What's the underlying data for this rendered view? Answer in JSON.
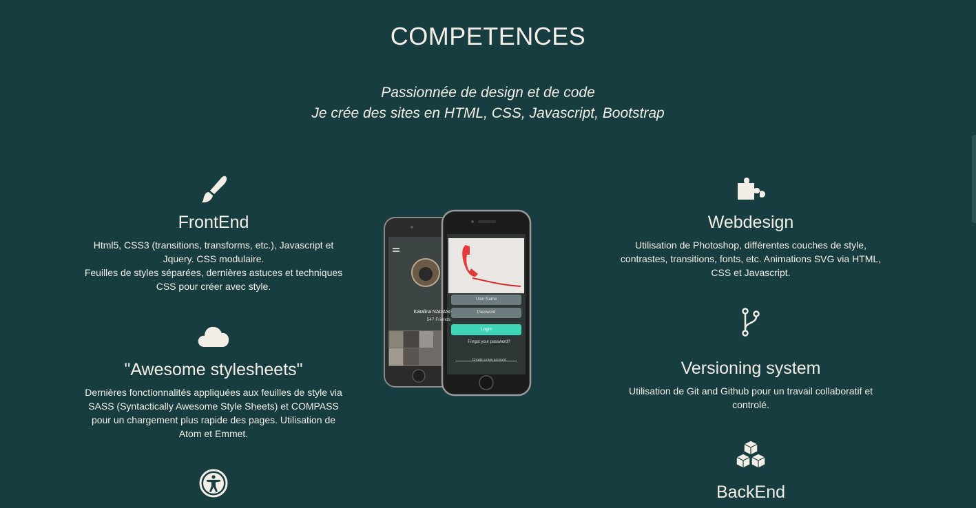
{
  "section": {
    "title": "COMPETENCES",
    "tagline_line1": "Passionnée de design et de code",
    "tagline_line2": "Je crée des sites en HTML, CSS, Javascript, Bootstrap"
  },
  "skills": {
    "frontend": {
      "icon": "paintbrush-icon",
      "title": "FrontEnd",
      "line1": "Html5, CSS3 (transitions, transforms, etc.), Javascript et Jquery. CSS modulaire.",
      "line2": "Feuilles de styles séparées, dernières astuces et techniques CSS pour créer avec style."
    },
    "stylesheets": {
      "icon": "cloud-icon",
      "title": "\"Awesome stylesheets\"",
      "desc": "Dernières fonctionnalités appliquées aux feuilles de style via SASS (Syntactically Awesome Style Sheets) et COMPASS pour un chargement plus rapide des pages. Utilisation de Atom et Emmet."
    },
    "accessibility": {
      "icon": "accessibility-icon"
    },
    "webdesign": {
      "icon": "puzzle-icon",
      "title": "Webdesign",
      "desc": "Utilisation de Photoshop, différentes couches de style, contrastes, transitions, fonts, etc. Animations SVG via HTML, CSS et Javascript."
    },
    "versioning": {
      "icon": "git-branch-icon",
      "title": "Versioning system",
      "desc": "Utilisation de Git and Github pour un travail collaboratif et controlé."
    },
    "backend": {
      "icon": "cubes-icon",
      "title": "BackEnd"
    }
  },
  "mockup": {
    "profile_name": "Katalina NADASI",
    "profile_friends": "547 Friends",
    "field_username": "User Name",
    "field_password": "Password",
    "login_label": "Login",
    "forgot_label": "Forgot your password?",
    "create_label": "Create a new account",
    "accent": "#3fd6b8"
  },
  "colors": {
    "background": "#173d40",
    "text": "#f4efe6"
  }
}
